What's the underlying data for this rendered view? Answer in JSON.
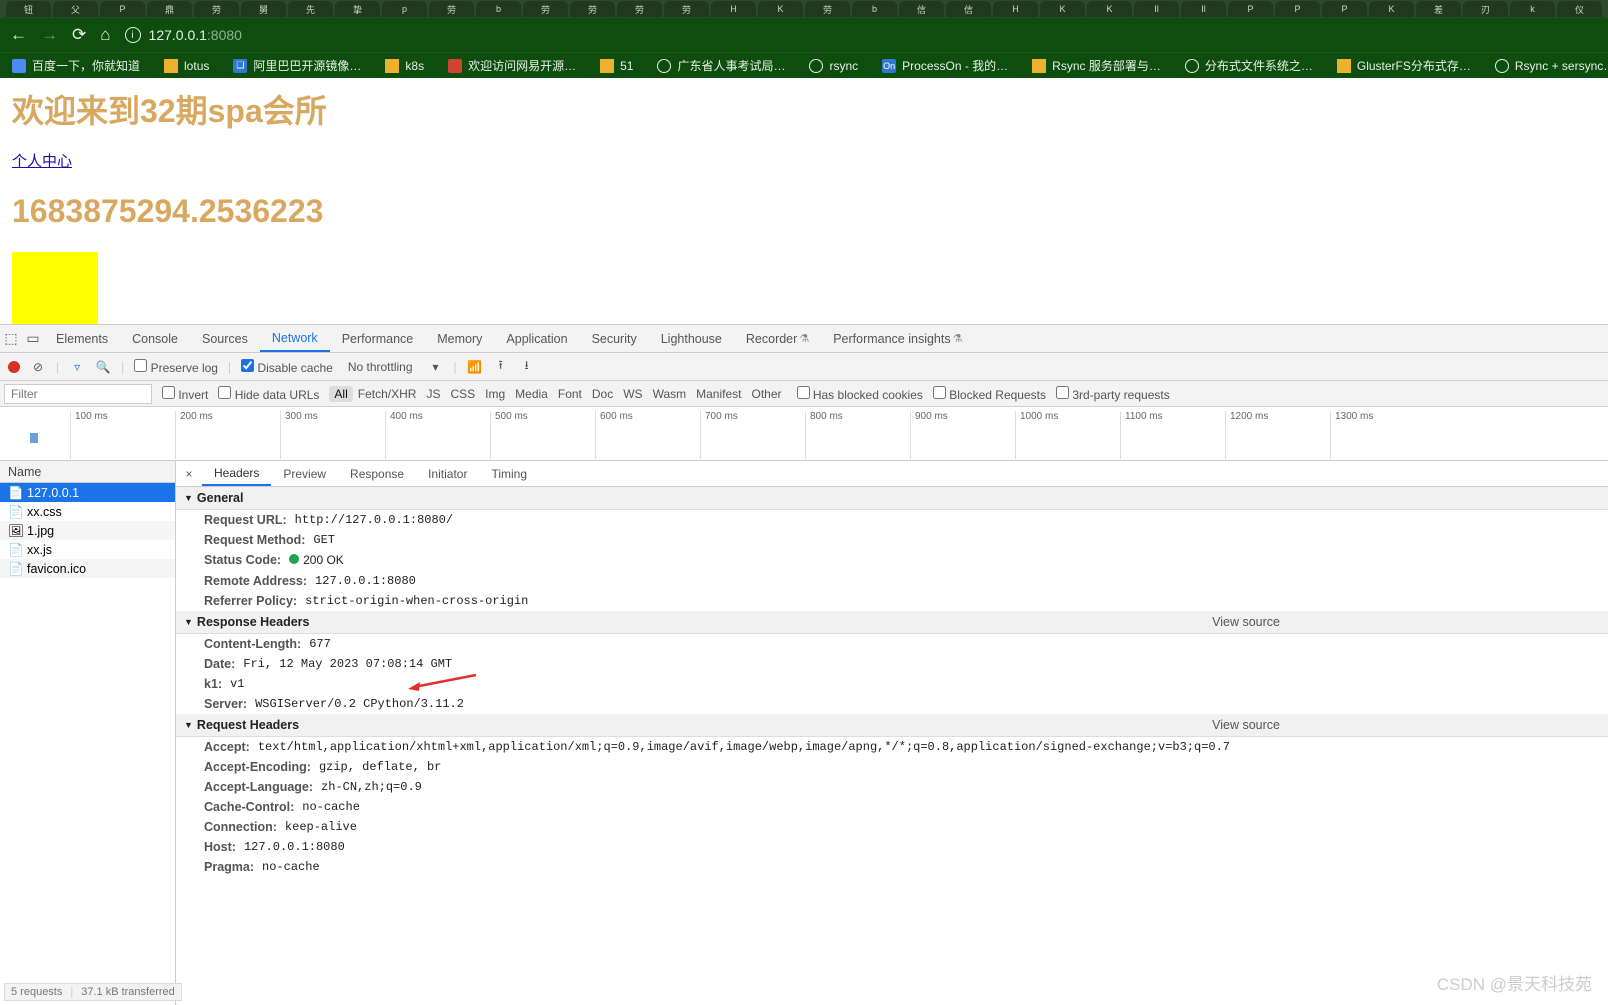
{
  "browser": {
    "tabs": [
      "钮",
      "父",
      "P",
      "鼎",
      "劳",
      "舅",
      "先",
      "挚",
      "p",
      "劳",
      "b",
      "劳",
      "劳",
      "劳",
      "劳",
      "H",
      "K",
      "劳",
      "b",
      "信",
      "信",
      "H",
      "K",
      "K",
      "Il",
      "Il",
      "P",
      "P",
      "P",
      "K",
      "差",
      "刃",
      "k",
      "仪"
    ],
    "url_host": "127.0.0.1",
    "url_port": ":8080",
    "bookmarks": [
      {
        "label": "百度一下，你就知道",
        "icon": "g"
      },
      {
        "label": "lotus",
        "icon": "f"
      },
      {
        "label": "阿里巴巴开源镜像…",
        "icon": "o",
        "glyph": "❑"
      },
      {
        "label": "k8s",
        "icon": "f"
      },
      {
        "label": "欢迎访问网易开源…",
        "icon": "r"
      },
      {
        "label": "51",
        "icon": "f"
      },
      {
        "label": "广东省人事考试局…",
        "icon": "b"
      },
      {
        "label": "rsync",
        "icon": "b"
      },
      {
        "label": "ProcessOn - 我的…",
        "icon": "o",
        "glyph": "On"
      },
      {
        "label": "Rsync 服务部署与…",
        "icon": "f"
      },
      {
        "label": "分布式文件系统之…",
        "icon": "b"
      },
      {
        "label": "GlusterFS分布式存…",
        "icon": "f"
      },
      {
        "label": "Rsync + sersync…",
        "icon": "b"
      }
    ]
  },
  "page": {
    "h1": "欢迎来到32期spa会所",
    "link": "个人中心",
    "timestamp": "1683875294.2536223"
  },
  "devtools": {
    "tabs": [
      "Elements",
      "Console",
      "Sources",
      "Network",
      "Performance",
      "Memory",
      "Application",
      "Security",
      "Lighthouse",
      "Recorder",
      "Performance insights"
    ],
    "active_tab": "Network",
    "toolbar": {
      "preserve_log": "Preserve log",
      "disable_cache": "Disable cache",
      "throttling": "No throttling"
    },
    "filter": {
      "placeholder": "Filter",
      "invert": "Invert",
      "hide_data": "Hide data URLs",
      "types": [
        "All",
        "Fetch/XHR",
        "JS",
        "CSS",
        "Img",
        "Media",
        "Font",
        "Doc",
        "WS",
        "Wasm",
        "Manifest",
        "Other"
      ],
      "blocked_cookies": "Has blocked cookies",
      "blocked_req": "Blocked Requests",
      "third": "3rd-party requests"
    },
    "timeline": [
      "100 ms",
      "200 ms",
      "300 ms",
      "400 ms",
      "500 ms",
      "600 ms",
      "700 ms",
      "800 ms",
      "900 ms",
      "1000 ms",
      "1100 ms",
      "1200 ms",
      "1300 ms"
    ],
    "requests_label": "Name",
    "requests": [
      "127.0.0.1",
      "xx.css",
      "1.jpg",
      "xx.js",
      "favicon.ico"
    ],
    "detail_tabs": [
      "Headers",
      "Preview",
      "Response",
      "Initiator",
      "Timing"
    ],
    "active_detail": "Headers",
    "view_source": "View source",
    "general_label": "General",
    "general": {
      "request_url_k": "Request URL:",
      "request_url_v": "http://127.0.0.1:8080/",
      "method_k": "Request Method:",
      "method_v": "GET",
      "status_k": "Status Code:",
      "status_v": "200 OK",
      "remote_k": "Remote Address:",
      "remote_v": "127.0.0.1:8080",
      "referrer_k": "Referrer Policy:",
      "referrer_v": "strict-origin-when-cross-origin"
    },
    "response_headers_label": "Response Headers",
    "response_headers": {
      "cl_k": "Content-Length:",
      "cl_v": "677",
      "date_k": "Date:",
      "date_v": "Fri, 12 May 2023 07:08:14 GMT",
      "k1_k": "k1:",
      "k1_v": "v1",
      "server_k": "Server:",
      "server_v": "WSGIServer/0.2 CPython/3.11.2"
    },
    "request_headers_label": "Request Headers",
    "request_headers": {
      "accept_k": "Accept:",
      "accept_v": "text/html,application/xhtml+xml,application/xml;q=0.9,image/avif,image/webp,image/apng,*/*;q=0.8,application/signed-exchange;v=b3;q=0.7",
      "ae_k": "Accept-Encoding:",
      "ae_v": "gzip, deflate, br",
      "al_k": "Accept-Language:",
      "al_v": "zh-CN,zh;q=0.9",
      "cc_k": "Cache-Control:",
      "cc_v": "no-cache",
      "conn_k": "Connection:",
      "conn_v": "keep-alive",
      "host_k": "Host:",
      "host_v": "127.0.0.1:8080",
      "prag_k": "Pragma:",
      "prag_v": "no-cache"
    },
    "status_bar": {
      "req": "5 requests",
      "size": "37.1 kB transferred"
    }
  },
  "watermark": "CSDN @景天科技苑"
}
